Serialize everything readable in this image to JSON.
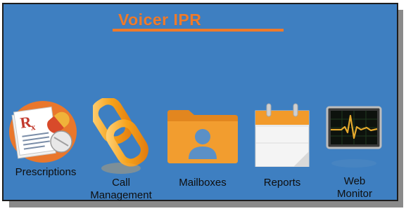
{
  "app": {
    "title": "Voicer IPR",
    "colors": {
      "background": "#3e7fc1",
      "title": "#ef7a2a",
      "border": "#1d1d1d"
    }
  },
  "launchers": [
    {
      "id": "prescriptions",
      "icon": "prescription-pills-icon",
      "label_lines": [
        "Prescriptions"
      ]
    },
    {
      "id": "call-management",
      "icon": "chain-link-icon",
      "label_lines": [
        "Call",
        "Management"
      ]
    },
    {
      "id": "mailboxes",
      "icon": "user-folder-icon",
      "label_lines": [
        "Mailboxes"
      ]
    },
    {
      "id": "reports",
      "icon": "calendar-icon",
      "label_lines": [
        "Reports"
      ]
    },
    {
      "id": "web-monitor",
      "icon": "heartbeat-monitor-icon",
      "label_lines": [
        "Web",
        "Monitor"
      ]
    }
  ]
}
